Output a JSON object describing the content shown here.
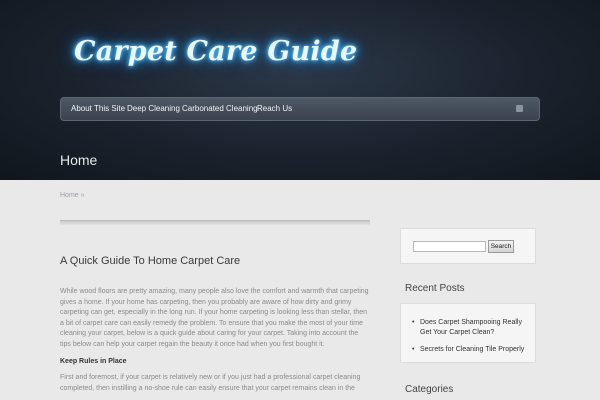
{
  "site": {
    "logo_text": "Carpet Care Guide"
  },
  "nav": {
    "items": [
      {
        "label": "About This Site"
      },
      {
        "label": "Deep Cleaning"
      },
      {
        "label": "Carbonated Cleaning"
      },
      {
        "label": "Reach Us"
      }
    ],
    "rss_icon": "rss-icon"
  },
  "page": {
    "title": "Home",
    "breadcrumb": "Home »"
  },
  "post": {
    "title": "A Quick Guide To Home Carpet Care",
    "paragraph1": "While wood floors are pretty amazing, many people also love the comfort and warmth that carpeting gives a home. If your home has carpeting, then you probably are aware of how dirty and grimy carpeting can get, especially in the long run. If your home carpeting is looking less than stellar, then a bit of carpet care can easily remedy the problem. To ensure that you make the most of your time cleaning your carpet, below is a quick guide about caring for your carpet. Taking into account the tips below can help your carpet regain the beauty it once had when you first bought it.",
    "subheading": "Keep Rules in Place",
    "paragraph2": "First and foremost, if your carpet is relatively new or if you just had a professional carpet cleaning completed, then instilling a no-shoe rule can easily ensure that your carpet remains clean in the"
  },
  "sidebar": {
    "search_placeholder": "",
    "search_button": "Search",
    "recent_title": "Recent Posts",
    "recent_posts": [
      {
        "bullet": "•",
        "label": "Does Carpet Shampooing Really Get Your Carpet Clean?"
      },
      {
        "bullet": "•",
        "label": "Secrets for Cleaning Tile Properly"
      }
    ],
    "categories_title": "Categories"
  }
}
